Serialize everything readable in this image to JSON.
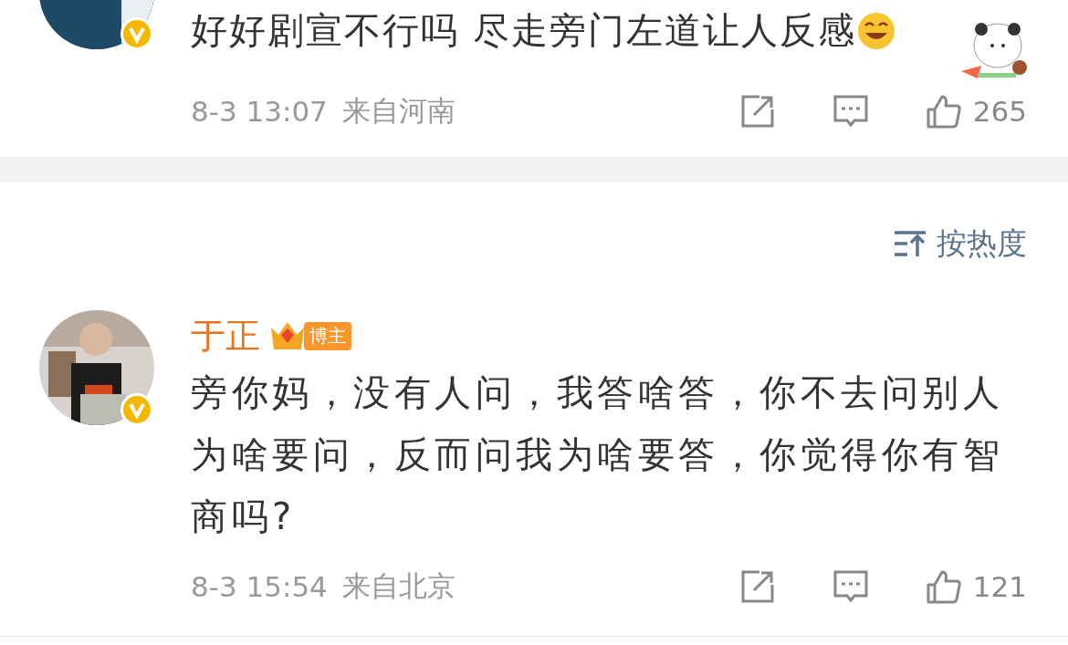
{
  "comments": [
    {
      "verified": true,
      "text": "好好剧宣不行吗 尽走旁门左道让人反感",
      "time": "8-3 13:07",
      "location": "来自河南",
      "like_count": "265",
      "sticker": true
    },
    {
      "verified": true,
      "name": "于正",
      "badge": "博主",
      "text": "旁你妈，没有人问，我答啥答，你不去问别人为啥要问，反而问我为啥要答，你觉得你有智商吗?",
      "time": "8-3 15:54",
      "location": "来自北京",
      "like_count": "121",
      "sticker": false
    }
  ],
  "sort": {
    "label": "按热度"
  }
}
